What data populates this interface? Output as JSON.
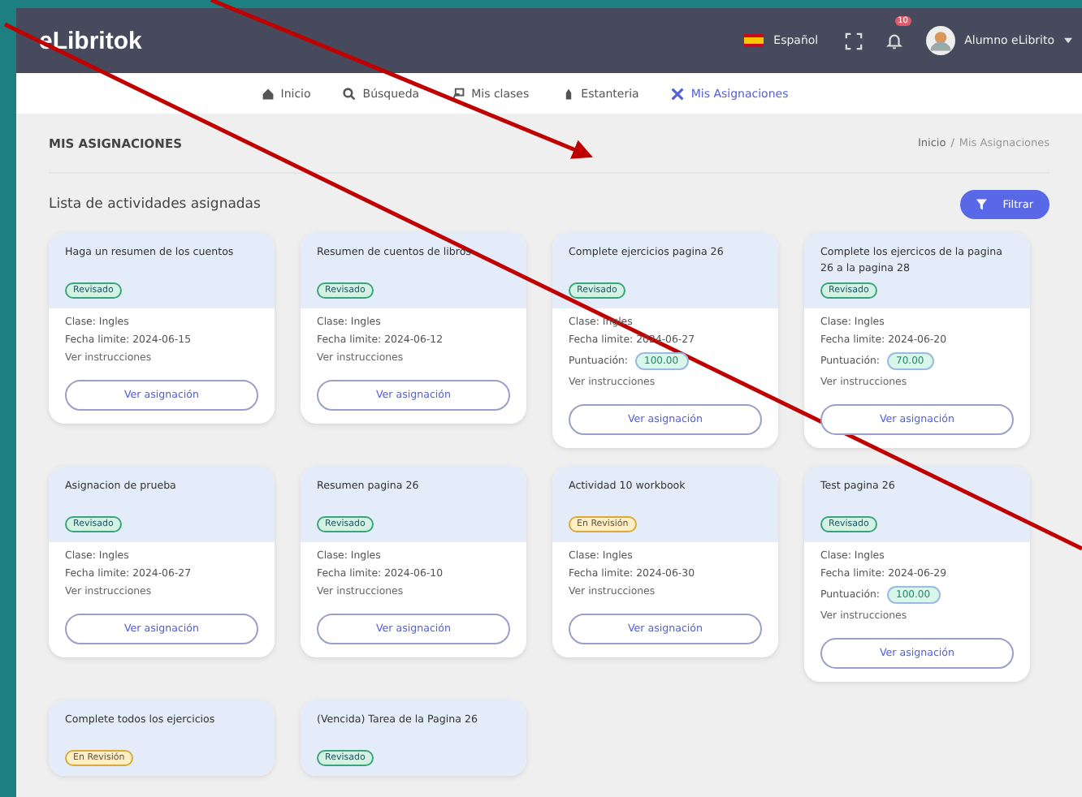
{
  "header": {
    "logo": "eLibritok",
    "language": "Español",
    "notification_count": "10",
    "user": "Alumno eLibrito"
  },
  "nav": [
    {
      "label": "Inicio",
      "selected": false
    },
    {
      "label": "Búsqueda",
      "selected": false
    },
    {
      "label": "Mis clases",
      "selected": false
    },
    {
      "label": "Estanteria",
      "selected": false
    },
    {
      "label": "Mis Asignaciones",
      "selected": true
    }
  ],
  "page_title": "MIS ASIGNACIONES",
  "breadcrumb": [
    "Inicio",
    "Mis Asignaciones"
  ],
  "breadcrumb_separator": "/",
  "section_title": "Lista de actividades asignadas",
  "filter_button": "Filtrar",
  "cards": [
    {
      "title": "Haga un resumen de los cuentos",
      "status": {
        "label": "Revisado",
        "kind": "reviewed"
      },
      "class": "Clase: Ingles",
      "deadline": "Fecha limite: 2024-06-15",
      "instructions": "Ver instrucciones",
      "button": "Ver asignación"
    },
    {
      "title": "Resumen de cuentos de libros",
      "status": {
        "label": "Revisado",
        "kind": "reviewed"
      },
      "class": "Clase: Ingles",
      "deadline": "Fecha limite: 2024-06-12",
      "instructions": "Ver instrucciones",
      "button": "Ver asignación"
    },
    {
      "title": "Complete ejercicios pagina 26",
      "status": {
        "label": "Revisado",
        "kind": "reviewed"
      },
      "class": "Clase: Ingles",
      "deadline": "Fecha limite: 2024-06-27",
      "score": {
        "label": "Puntuación:",
        "value": "100.00"
      },
      "instructions": "Ver instrucciones",
      "button": "Ver asignación"
    },
    {
      "title": "Complete los ejercicos de la pagina 26 a la pagina 28",
      "status": {
        "label": "Revisado",
        "kind": "reviewed"
      },
      "class": "Clase: Ingles",
      "deadline": "Fecha limite: 2024-06-20",
      "score": {
        "label": "Puntuación:",
        "value": "70.00"
      },
      "instructions": "Ver instrucciones",
      "button": "Ver asignación"
    },
    {
      "title": "Asignacion de prueba",
      "status": {
        "label": "Revisado",
        "kind": "reviewed"
      },
      "class": "Clase: Ingles",
      "deadline": "Fecha limite: 2024-06-27",
      "instructions": "Ver instrucciones",
      "button": "Ver asignación"
    },
    {
      "title": "Resumen pagina 26",
      "status": {
        "label": "Revisado",
        "kind": "reviewed"
      },
      "class": "Clase: Ingles",
      "deadline": "Fecha limite: 2024-06-10",
      "instructions": "Ver instrucciones",
      "button": "Ver asignación"
    },
    {
      "title": "Actividad 10 workbook",
      "status": {
        "label": "En Revisión",
        "kind": "in_review"
      },
      "class": "Clase: Ingles",
      "deadline": "Fecha limite: 2024-06-30",
      "instructions": "Ver instrucciones",
      "button": "Ver asignación"
    },
    {
      "title": "Test pagina 26",
      "status": {
        "label": "Revisado",
        "kind": "reviewed"
      },
      "class": "Clase: Ingles",
      "deadline": "Fecha limite: 2024-06-29",
      "score": {
        "label": "Puntuación:",
        "value": "100.00"
      },
      "instructions": "Ver instrucciones",
      "button": "Ver asignación"
    },
    {
      "title": "Complete todos los ejercicios",
      "status": {
        "label": "En Revisión",
        "kind": "in_review"
      }
    },
    {
      "title": "(Vencida) Tarea de la Pagina 26",
      "status": {
        "label": "Revisado",
        "kind": "reviewed"
      }
    }
  ]
}
